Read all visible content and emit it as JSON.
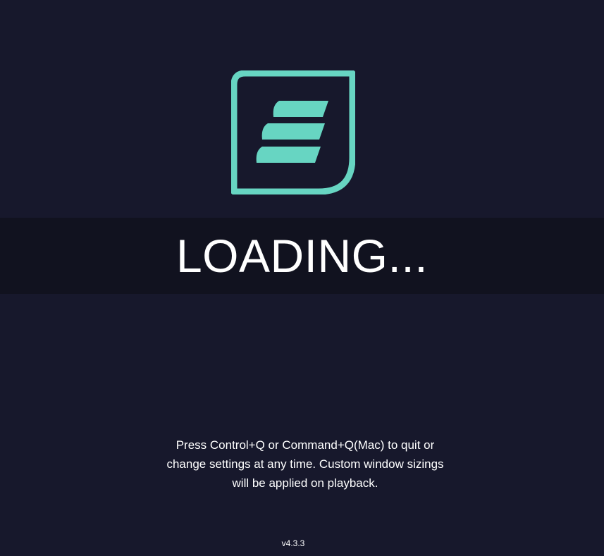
{
  "app": {
    "logo_icon": "app-logo-icon",
    "accent_color": "#67d5c2",
    "background_color": "#17182c",
    "band_color": "#11121f"
  },
  "loading": {
    "text": "LOADING..."
  },
  "notice": {
    "lines": [
      "Press Control+Q or Command+Q(Mac) to quit or",
      "change settings at any time. Custom window sizings",
      "will be applied on playback."
    ]
  },
  "footer": {
    "version": "v4.3.3"
  }
}
